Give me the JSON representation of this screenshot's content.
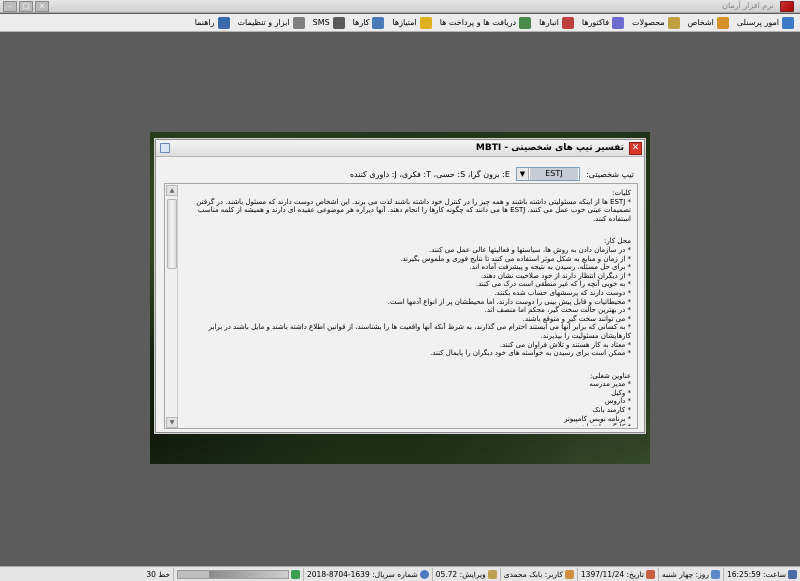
{
  "app": {
    "title": "نرم افزار آرمان"
  },
  "menu": [
    {
      "label": "امور پرسنلی",
      "color": "#3b7ac7"
    },
    {
      "label": "اشخاص",
      "color": "#d6902a"
    },
    {
      "label": "محصولات",
      "color": "#c0a040"
    },
    {
      "label": "فاکتورها",
      "color": "#6b6bd0"
    },
    {
      "label": "انبارها",
      "color": "#c04040"
    },
    {
      "label": "دریافت ها و پرداخت ها",
      "color": "#4a8a4a"
    },
    {
      "label": "امتیازها",
      "color": "#e0b020"
    },
    {
      "label": "کارها",
      "color": "#4a7ab8"
    },
    {
      "label": "SMS",
      "color": "#5a5a5a"
    },
    {
      "label": "ابزار و تنظیمات",
      "color": "#808080"
    },
    {
      "label": "راهنما",
      "color": "#3a6aaa"
    }
  ],
  "dialog": {
    "title": "تفسیر تیپ های شخصیتی - MBTI",
    "type_label": "تیپ شخصیتی:",
    "selected_type": "ESTJ",
    "legend": "E: برون گرا، S: حسی، T: فکری، J: داوری کننده",
    "sections": [
      {
        "title": "کلیات:",
        "lines": [
          "* ESTJ ها از اینکه مسئولیتی داشته باشند و همه چیز را در کنترل خود داشته باشند لذت می برند. این اشخاص دوست دارند که مسئول باشند. در گرفتن",
          "تصمیمات عینی خوب عمل می کنند. ESTJ ها می دانند که چگونه کارها را انجام دهند. آنها دیراره هر موضوعی عقیده ای دارند و همیشه از کلمه مناسب",
          "استفاده کنند."
        ]
      },
      {
        "title": "محل کار:",
        "lines": [
          "* در سازمان دادن به روش ها، سیاستها و فعالیتها عالی عمل می کنند.",
          "* از زمان و منابع به شکل موثر استفاده می کنند تا نتایج فوری و ملموس بگیرند.",
          "* برای حل مسئله، رسیدن به نتیجه و پیشرفت آماده اند.",
          "* از دیگران انتظار دارند از خود صلاحیت نشان دهند.",
          "* به خوبی آنچه را که غیر منطقی است درک می کنند.",
          "* دوست دارند که پرسشهای حساب شده بکنند.",
          "* محیطاتیات و قابل پیش بینی را دوست دارند، اما محیطشان پر از انواع آدمها است.",
          "* در بهترین حالت سخت گیر، محکم اما منصف اند.",
          "* می توانند سخت گیر و متوقع باشند.",
          "* به کسانی که برابر آنها می ایستند احترام می گذارند، به شرط آنکه آنها واقعیت ها را بشناسند، از قوانین اطلاع داشته باشند و مایل باشند در برابر",
          "کارهایشان مسئولیت را بپذیرند.",
          "* معتاد به کار هستند و تلاش فراوان می کنند.",
          "* ممکن است برای رسیدن به خواسته های خود دیگران را پایمال کنند."
        ]
      },
      {
        "title": "عناوین شغلی:",
        "lines": [
          "* مدیر مدرسه",
          "* وکیل",
          "* داروس",
          "* کارمند بانک",
          "* برنامه نویس کامپیوتر",
          "* کارگر ساختمان"
        ]
      }
    ]
  },
  "status": {
    "time": "ساعت: 16:25:59",
    "day": "روز: چهار شنبه",
    "date": "تاریخ: 1397/11/24",
    "user": "کاربر: بابک محمدی",
    "version": "ویرایش: 05.72",
    "serial": "شماره سریال: 1639-8704-2018",
    "line": "خط 30",
    "progress": 0.72
  }
}
